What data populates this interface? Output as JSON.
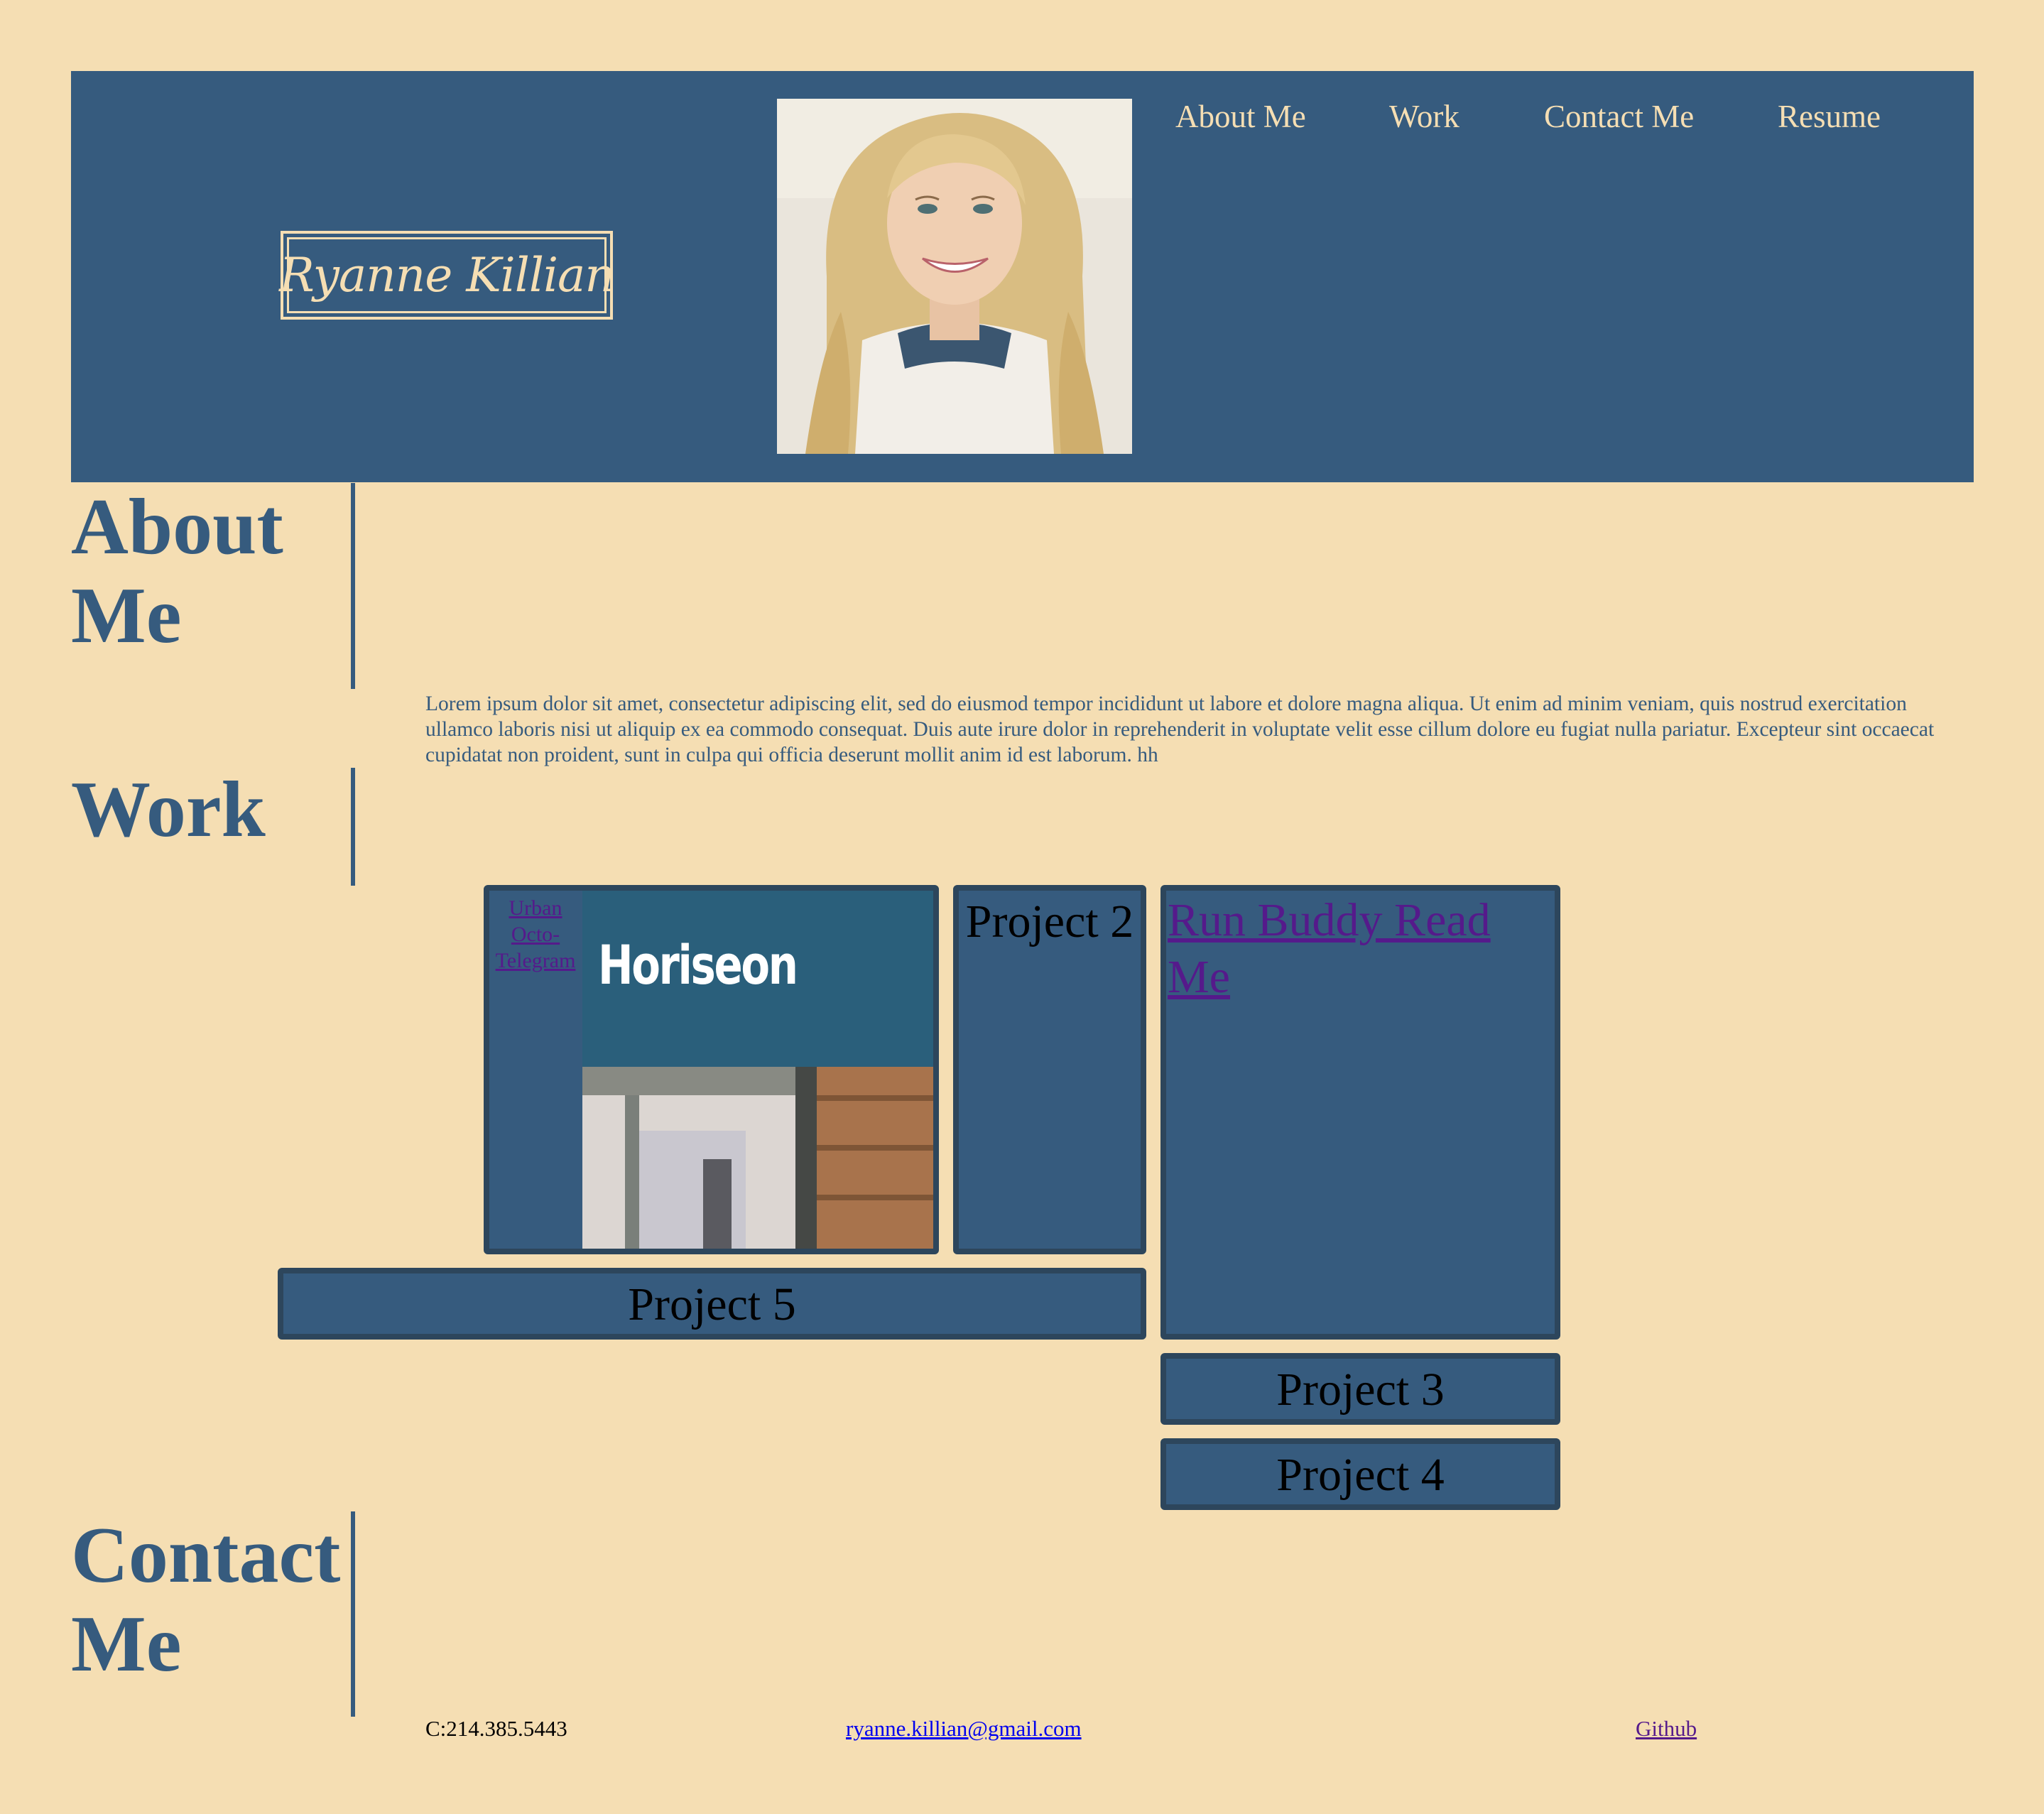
{
  "header": {
    "name": "Ryanne Killian",
    "nav": [
      "About Me",
      "Work",
      "Contact Me",
      "Resume"
    ]
  },
  "sections": {
    "about": {
      "title_line1": "About",
      "title_line2": "Me",
      "text": "Lorem ipsum dolor sit amet, consectetur adipiscing elit, sed do eiusmod tempor incididunt ut labore et dolore magna aliqua. Ut enim ad minim veniam, quis nostrud exercitation ullamco laboris nisi ut aliquip ex ea commodo consequat. Duis aute irure dolor in reprehenderit in voluptate velit esse cillum dolore eu fugiat nulla pariatur. Excepteur sint occaecat cupidatat non proident, sunt in culpa qui officia deserunt mollit anim id est laborum. hh"
    },
    "work": {
      "title": "Work",
      "projects": {
        "p1_link": "Urban Octo-Telegram",
        "p1_screenshot_logo": "Horiseon",
        "p2": "Project 2",
        "run_buddy": "Run Buddy Read Me",
        "p3": "Project 3",
        "p4": "Project 4",
        "p5": "Project 5"
      }
    },
    "contact": {
      "title_line1": "Contact",
      "title_line2": "Me",
      "phone": "C:214.385.5443",
      "email": "ryanne.killian@gmail.com",
      "github": "Github"
    }
  },
  "colors": {
    "background": "#f5deb3",
    "primary": "#365b7e",
    "card_border": "#2d465c",
    "visited_link": "#551a8b",
    "link": "#0000ee"
  }
}
